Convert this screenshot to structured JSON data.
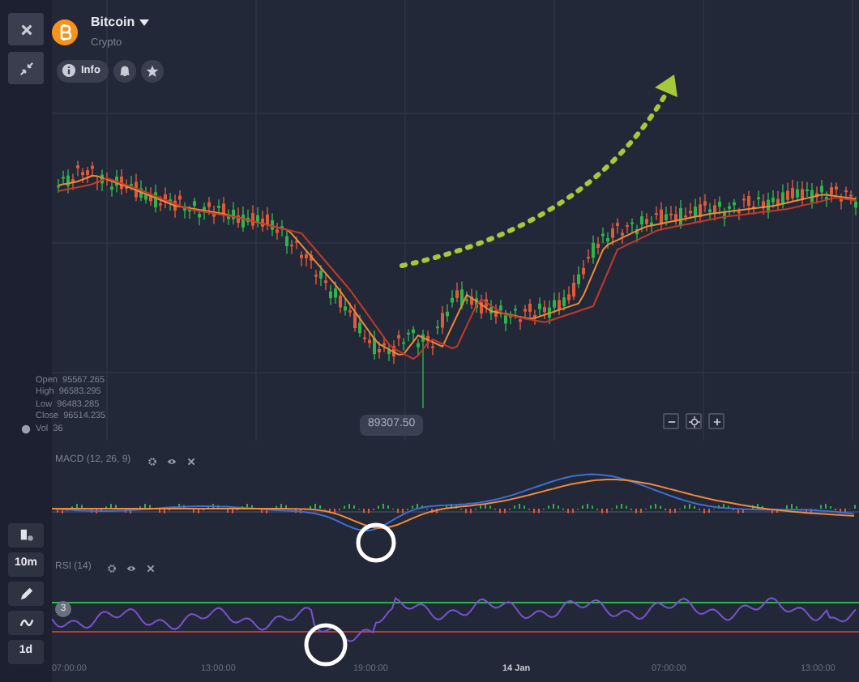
{
  "asset": {
    "name": "Bitcoin",
    "category": "Crypto"
  },
  "asset_actions": [
    {
      "kind": "info",
      "label": "Info"
    },
    {
      "kind": "bell"
    },
    {
      "kind": "star"
    }
  ],
  "side_tools_top": [
    {
      "kind": "close"
    },
    {
      "kind": "collapse"
    }
  ],
  "side_tools_bottom": [
    {
      "kind": "chart_type"
    },
    {
      "kind": "text",
      "label": "10m"
    },
    {
      "kind": "draw"
    },
    {
      "kind": "indicator"
    },
    {
      "kind": "text",
      "label": "1d"
    }
  ],
  "ohlc": [
    {
      "label": "Open",
      "value": "95567.265"
    },
    {
      "label": "High",
      "value": "96583.295"
    },
    {
      "label": "Low",
      "value": "96483.285"
    },
    {
      "label": "Close",
      "value": "96514.235"
    },
    {
      "label": "Vol",
      "value": "36"
    }
  ],
  "price_tag": "89307.50",
  "zoom_controls": [
    {
      "kind": "minus"
    },
    {
      "kind": "reset"
    },
    {
      "kind": "plus"
    }
  ],
  "indicators": [
    {
      "label": "MACD (12, 26, 9)"
    },
    {
      "label": "RSI (14)"
    }
  ],
  "rsi_badge": "3",
  "x_axis": [
    {
      "label": "07:00:00",
      "emphasized": false
    },
    {
      "label": "13:00:00",
      "emphasized": false
    },
    {
      "label": "19:00:00",
      "emphasized": false
    },
    {
      "label": "14 Jan",
      "emphasized": true
    },
    {
      "label": "07:00:00",
      "emphasized": false
    },
    {
      "label": "13:00:00",
      "emphasized": false
    }
  ]
}
